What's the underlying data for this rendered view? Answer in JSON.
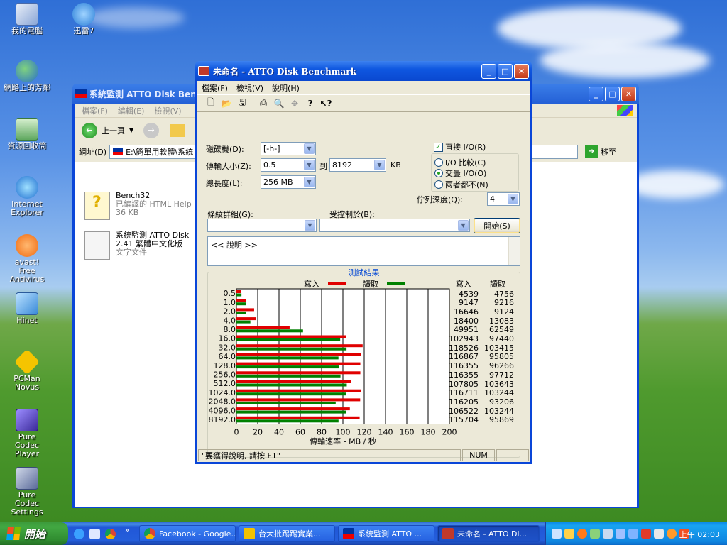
{
  "desktop": {
    "icons": [
      {
        "label": "我的電腦",
        "icon": "my-computer-icon"
      },
      {
        "label": "迅雷7",
        "icon": "thunder-icon"
      },
      {
        "label": "網路上的芳鄰",
        "icon": "network-icon"
      },
      {
        "label": "資源回收筒",
        "icon": "recycle-bin-icon"
      },
      {
        "label": "Internet Explorer",
        "icon": "ie-icon"
      },
      {
        "label": "avast! Free Antivirus",
        "icon": "avast-icon"
      },
      {
        "label": "Hinet",
        "icon": "hinet-icon"
      },
      {
        "label": "PCMan Novus",
        "icon": "pcman-icon"
      },
      {
        "label": "Pure Codec Player",
        "icon": "player-icon"
      },
      {
        "label": "Pure Codec Settings",
        "icon": "settings-icon"
      }
    ]
  },
  "explorer": {
    "title": "系統監測  ATTO Disk Ben",
    "menu": [
      "檔案(F)",
      "編輯(E)",
      "檢視(V)"
    ],
    "back_label": "上一頁",
    "address_label": "網址(D)",
    "address_value": "E:\\簡單用軟體\\系統",
    "go_label": "移至",
    "files": [
      {
        "name": "Bench32",
        "sub1": "已編譯的 HTML Help",
        "sub2": "36 KB"
      },
      {
        "name": "系統監測  ATTO Disk",
        "sub1": "2.41 繁體中文化版",
        "sub2": "文字文件"
      }
    ]
  },
  "atto": {
    "title": "未命名 - ATTO Disk Benchmark",
    "menu": [
      "檔案(F)",
      "檢視(V)",
      "說明(H)"
    ],
    "drive_label": "磁碟機(D):",
    "drive_value": "[-h-]",
    "transfer_label": "傳輸大小(Z):",
    "transfer_from": "0.5",
    "to_label": "到",
    "transfer_to": "8192",
    "kb_label": "KB",
    "total_label": "總長度(L):",
    "total_value": "256 MB",
    "direct_io_label": "直接 I/O(R)",
    "direct_io_checked": true,
    "radio_io_compare": "I/O 比較(C)",
    "radio_overlapped": "交疊 I/O(O)",
    "radio_neither": "兩者都不(N)",
    "selected_radio": "交疊 I/O(O)",
    "queue_label": "佇列深度(Q):",
    "queue_value": "4",
    "pattern_label": "條紋群組(G):",
    "controlled_label": "受控制於(B):",
    "start_button": "開始(S)",
    "memo_text": "<< 說明 >>",
    "results_title": "測試結果",
    "legend_write": "寫入",
    "legend_read": "讀取",
    "col_write": "寫入",
    "col_read": "讀取",
    "status_text": "\"要獲得說明, 請按 F1\"",
    "status_num": "NUM"
  },
  "chart_data": {
    "type": "bar",
    "orientation": "horizontal",
    "title": "測試結果",
    "xlabel": "傳輸速率 - MB / 秒",
    "xlim": [
      0,
      200
    ],
    "xticks": [
      "0",
      "20",
      "40",
      "60",
      "80",
      "100",
      "120",
      "140",
      "160",
      "180",
      "200"
    ],
    "categories": [
      "0.5",
      "1.0",
      "2.0",
      "4.0",
      "8.0",
      "16.0",
      "32.0",
      "64.0",
      "128.0",
      "256.0",
      "512.0",
      "1024.0",
      "2048.0",
      "4096.0",
      "8192.0"
    ],
    "series": [
      {
        "name": "寫入",
        "color": "#e00000",
        "values": [
          4539,
          9147,
          16646,
          18400,
          49951,
          102943,
          118526,
          116867,
          116355,
          116355,
          107805,
          116711,
          116205,
          106522,
          115704
        ]
      },
      {
        "name": "讀取",
        "color": "#008000",
        "values": [
          4756,
          9216,
          9124,
          13083,
          62549,
          97440,
          103415,
          95805,
          96266,
          97712,
          103643,
          103244,
          93206,
          103244,
          95869
        ]
      }
    ],
    "units_note": "values shown in KB/s as printed in table"
  },
  "taskbar": {
    "start_label": "開始",
    "buttons": [
      {
        "label": "Facebook - Google...",
        "color": "#dd4b39"
      },
      {
        "label": "台大批踢踢實業...",
        "color": "#f2c200"
      },
      {
        "label": "系統監測  ATTO ...",
        "color": "#c0392b"
      },
      {
        "label": "未命名 - ATTO Di...",
        "color": "#c0392b"
      }
    ],
    "clock": "上午 02:03"
  }
}
